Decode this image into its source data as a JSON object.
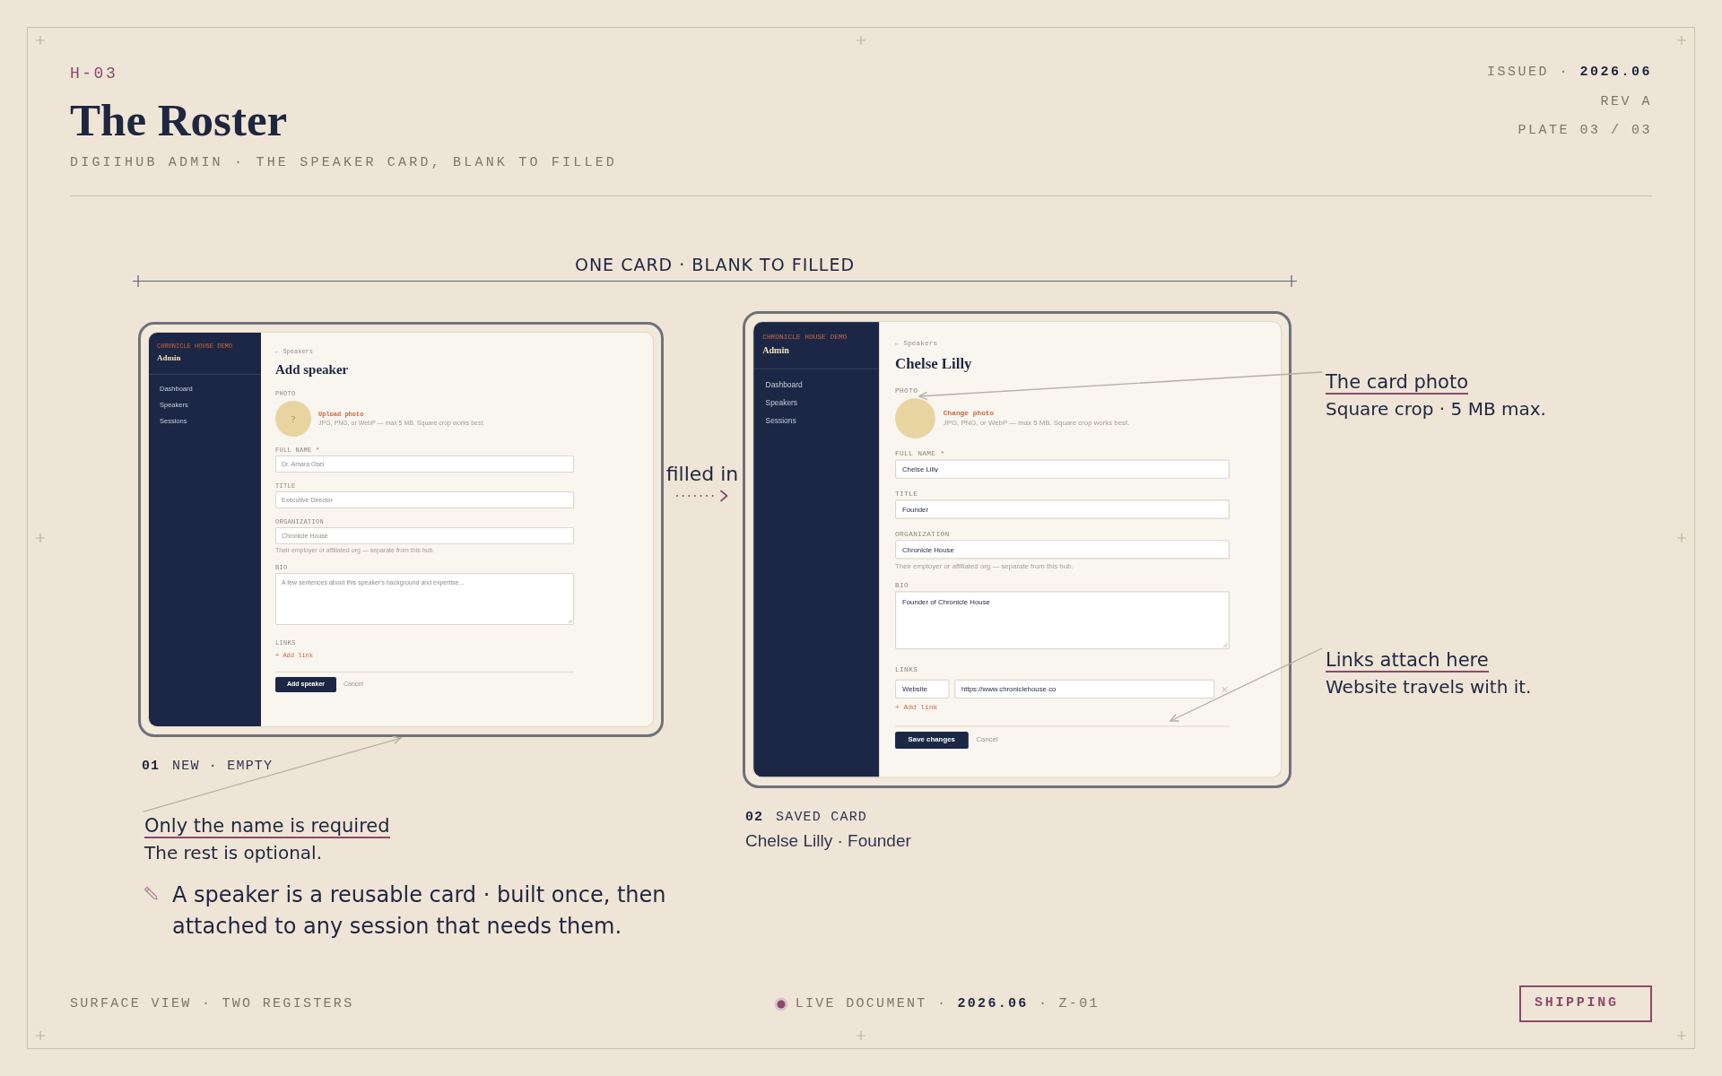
{
  "plate": {
    "code": "H-03",
    "title": "The Roster",
    "subtitle": "DIGIIHUB ADMIN · THE SPEAKER CARD, BLANK TO FILLED",
    "issued": "ISSUED · **2026.06**",
    "revision": "REV A",
    "plate_number": "PLATE 03 / 03"
  },
  "dimension_label": "ONE CARD · BLANK TO FILLED",
  "transition_label": "filled in",
  "screens": [
    {
      "number": "01",
      "caption": "NEW · EMPTY",
      "sidebar": {
        "eyebrow": "CHRONICLE HOUSE DEMO",
        "title": "Admin",
        "items": [
          {
            "label": "Dashboard",
            "selected": false
          },
          {
            "label": "Speakers",
            "selected": false
          },
          {
            "label": "Sessions",
            "selected": false
          }
        ]
      },
      "back_link": "← Speakers",
      "heading": "Add speaker",
      "photo": {
        "label": "PHOTO",
        "avatar_text": "?",
        "action": "Upload photo",
        "hint": "JPG, PNG, or WebP — max 5 MB. Square crop works best."
      },
      "fields": [
        {
          "kind": "input",
          "label": "FULL NAME",
          "required_mark": "*",
          "placeholder": "Dr. Amara Osei"
        },
        {
          "kind": "input",
          "label": "TITLE",
          "placeholder": "Executive Director"
        },
        {
          "kind": "input",
          "label": "ORGANIZATION",
          "placeholder": "Chronicle House",
          "hint": "Their employer or affiliated org — separate from this hub."
        },
        {
          "kind": "textarea",
          "label": "BIO",
          "placeholder": "A few sentences about this speaker's background and expertise..."
        }
      ],
      "links": {
        "label": "LINKS",
        "add": "+ Add link"
      },
      "primary_action": "Add speaker",
      "cancel": "Cancel"
    },
    {
      "number": "02",
      "caption": "SAVED CARD",
      "detail": "Chelse Lilly · Founder",
      "sidebar": {
        "eyebrow": "CHRONICLE HOUSE DEMO",
        "title": "Admin",
        "items": [
          {
            "label": "Dashboard",
            "selected": false
          },
          {
            "label": "Speakers",
            "selected": false
          },
          {
            "label": "Sessions",
            "selected": false
          }
        ]
      },
      "back_link": "← Speakers",
      "heading": "Chelse Lilly",
      "photo": {
        "label": "PHOTO",
        "action": "Change photo",
        "hint": "JPG, PNG, or WebP — max 5 MB. Square crop works best."
      },
      "fields": [
        {
          "kind": "input",
          "label": "FULL NAME",
          "required_mark": "*",
          "value": "Chelse Lilly"
        },
        {
          "kind": "input",
          "label": "TITLE",
          "value": "Founder"
        },
        {
          "kind": "input",
          "label": "ORGANIZATION",
          "value": "Chronicle House",
          "hint": "Their employer or affiliated org — separate from this hub."
        },
        {
          "kind": "textarea",
          "label": "BIO",
          "value": "Founder of Chronicle House"
        }
      ],
      "links": {
        "label": "LINKS",
        "rows": [
          {
            "label": "Website",
            "url": "https://www.chroniclehouse.co"
          }
        ],
        "add": "+ Add link"
      },
      "primary_action": "Save changes",
      "cancel": "Cancel"
    }
  ],
  "notes": [
    {
      "heading": "The card photo",
      "text": "Square crop · 5 MB max."
    },
    {
      "heading": "Links attach here",
      "text": "Website travels with it."
    },
    {
      "heading": "Only the name is required",
      "text": "The rest is optional."
    }
  ],
  "footnote": "A speaker is a reusable card · built once, then attached to any session that needs them.",
  "footer": {
    "left": "SURFACE VIEW · TWO REGISTERS",
    "status": "LIVE DOCUMENT · **2026.06** · Z-01",
    "stamp": "SHIPPING"
  }
}
